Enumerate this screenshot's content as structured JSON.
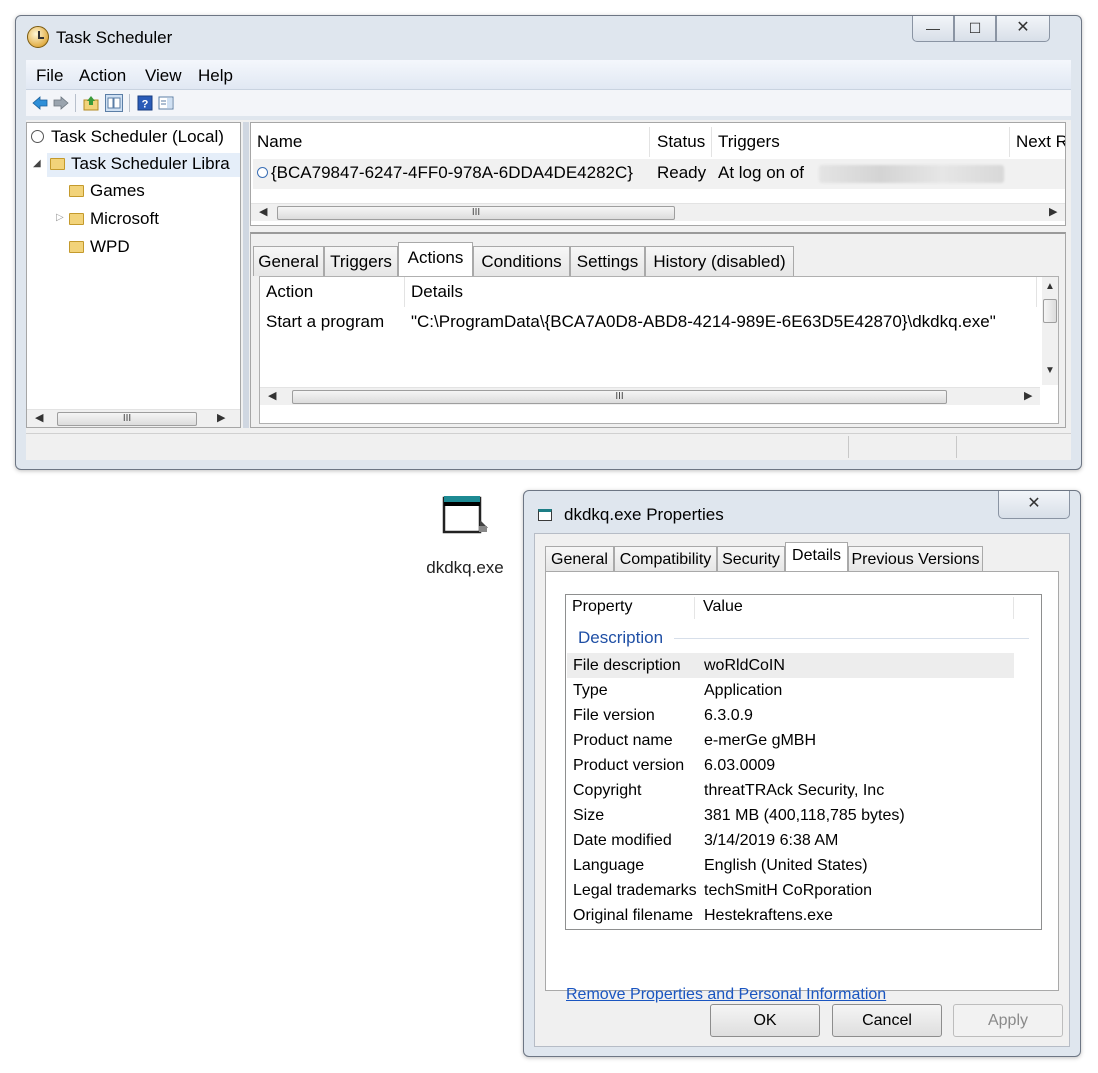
{
  "task_scheduler": {
    "title": "Task Scheduler",
    "caption_buttons": {
      "minimize": "—",
      "maximize": "☐",
      "close": "✕"
    },
    "menu": [
      "File",
      "Action",
      "View",
      "Help"
    ],
    "tree": {
      "root": "Task Scheduler (Local)",
      "library": "Task Scheduler Libra",
      "folders": [
        "Games",
        "Microsoft",
        "WPD"
      ]
    },
    "task_list": {
      "columns": [
        "Name",
        "Status",
        "Triggers",
        "Next Ru"
      ],
      "row": {
        "name": "{BCA79847-6247-4FF0-978A-6DDA4DE4282C}",
        "status": "Ready",
        "triggers": "At log on of"
      }
    },
    "tabs": [
      "General",
      "Triggers",
      "Actions",
      "Conditions",
      "Settings",
      "History (disabled)"
    ],
    "active_tab": "Actions",
    "actions_grid": {
      "columns": [
        "Action",
        "Details"
      ],
      "rows": [
        {
          "action": "Start a program",
          "details": "\"C:\\ProgramData\\{BCA7A0D8-ABD8-4214-989E-6E63D5E42870}\\dkdkq.exe\""
        }
      ]
    },
    "scroll_grip": "III"
  },
  "desktop_icon": {
    "label": "dkdkq.exe"
  },
  "properties": {
    "title": "dkdkq.exe Properties",
    "close": "✕",
    "tabs": [
      "General",
      "Compatibility",
      "Security",
      "Details",
      "Previous Versions"
    ],
    "active_tab": "Details",
    "list_header": {
      "property": "Property",
      "value": "Value"
    },
    "section": "Description",
    "rows": [
      {
        "k": "File description",
        "v": "woRldCoIN"
      },
      {
        "k": "Type",
        "v": "Application"
      },
      {
        "k": "File version",
        "v": "6.3.0.9"
      },
      {
        "k": "Product name",
        "v": "e-merGe gMBH"
      },
      {
        "k": "Product version",
        "v": "6.03.0009"
      },
      {
        "k": "Copyright",
        "v": "threatTRAck Security, Inc"
      },
      {
        "k": "Size",
        "v": "381 MB (400,118,785 bytes)"
      },
      {
        "k": "Date modified",
        "v": "3/14/2019 6:38 AM"
      },
      {
        "k": "Language",
        "v": "English (United States)"
      },
      {
        "k": "Legal trademarks",
        "v": "techSmitH CoRporation"
      },
      {
        "k": "Original filename",
        "v": "Hestekraftens.exe"
      }
    ],
    "remove_link": "Remove Properties and Personal Information",
    "buttons": {
      "ok": "OK",
      "cancel": "Cancel",
      "apply": "Apply"
    }
  },
  "colors": {
    "window_frame": "#dfe6ee",
    "link": "#1a55c0",
    "section_header": "#1f4fa5",
    "selected_row": "#ededed"
  }
}
